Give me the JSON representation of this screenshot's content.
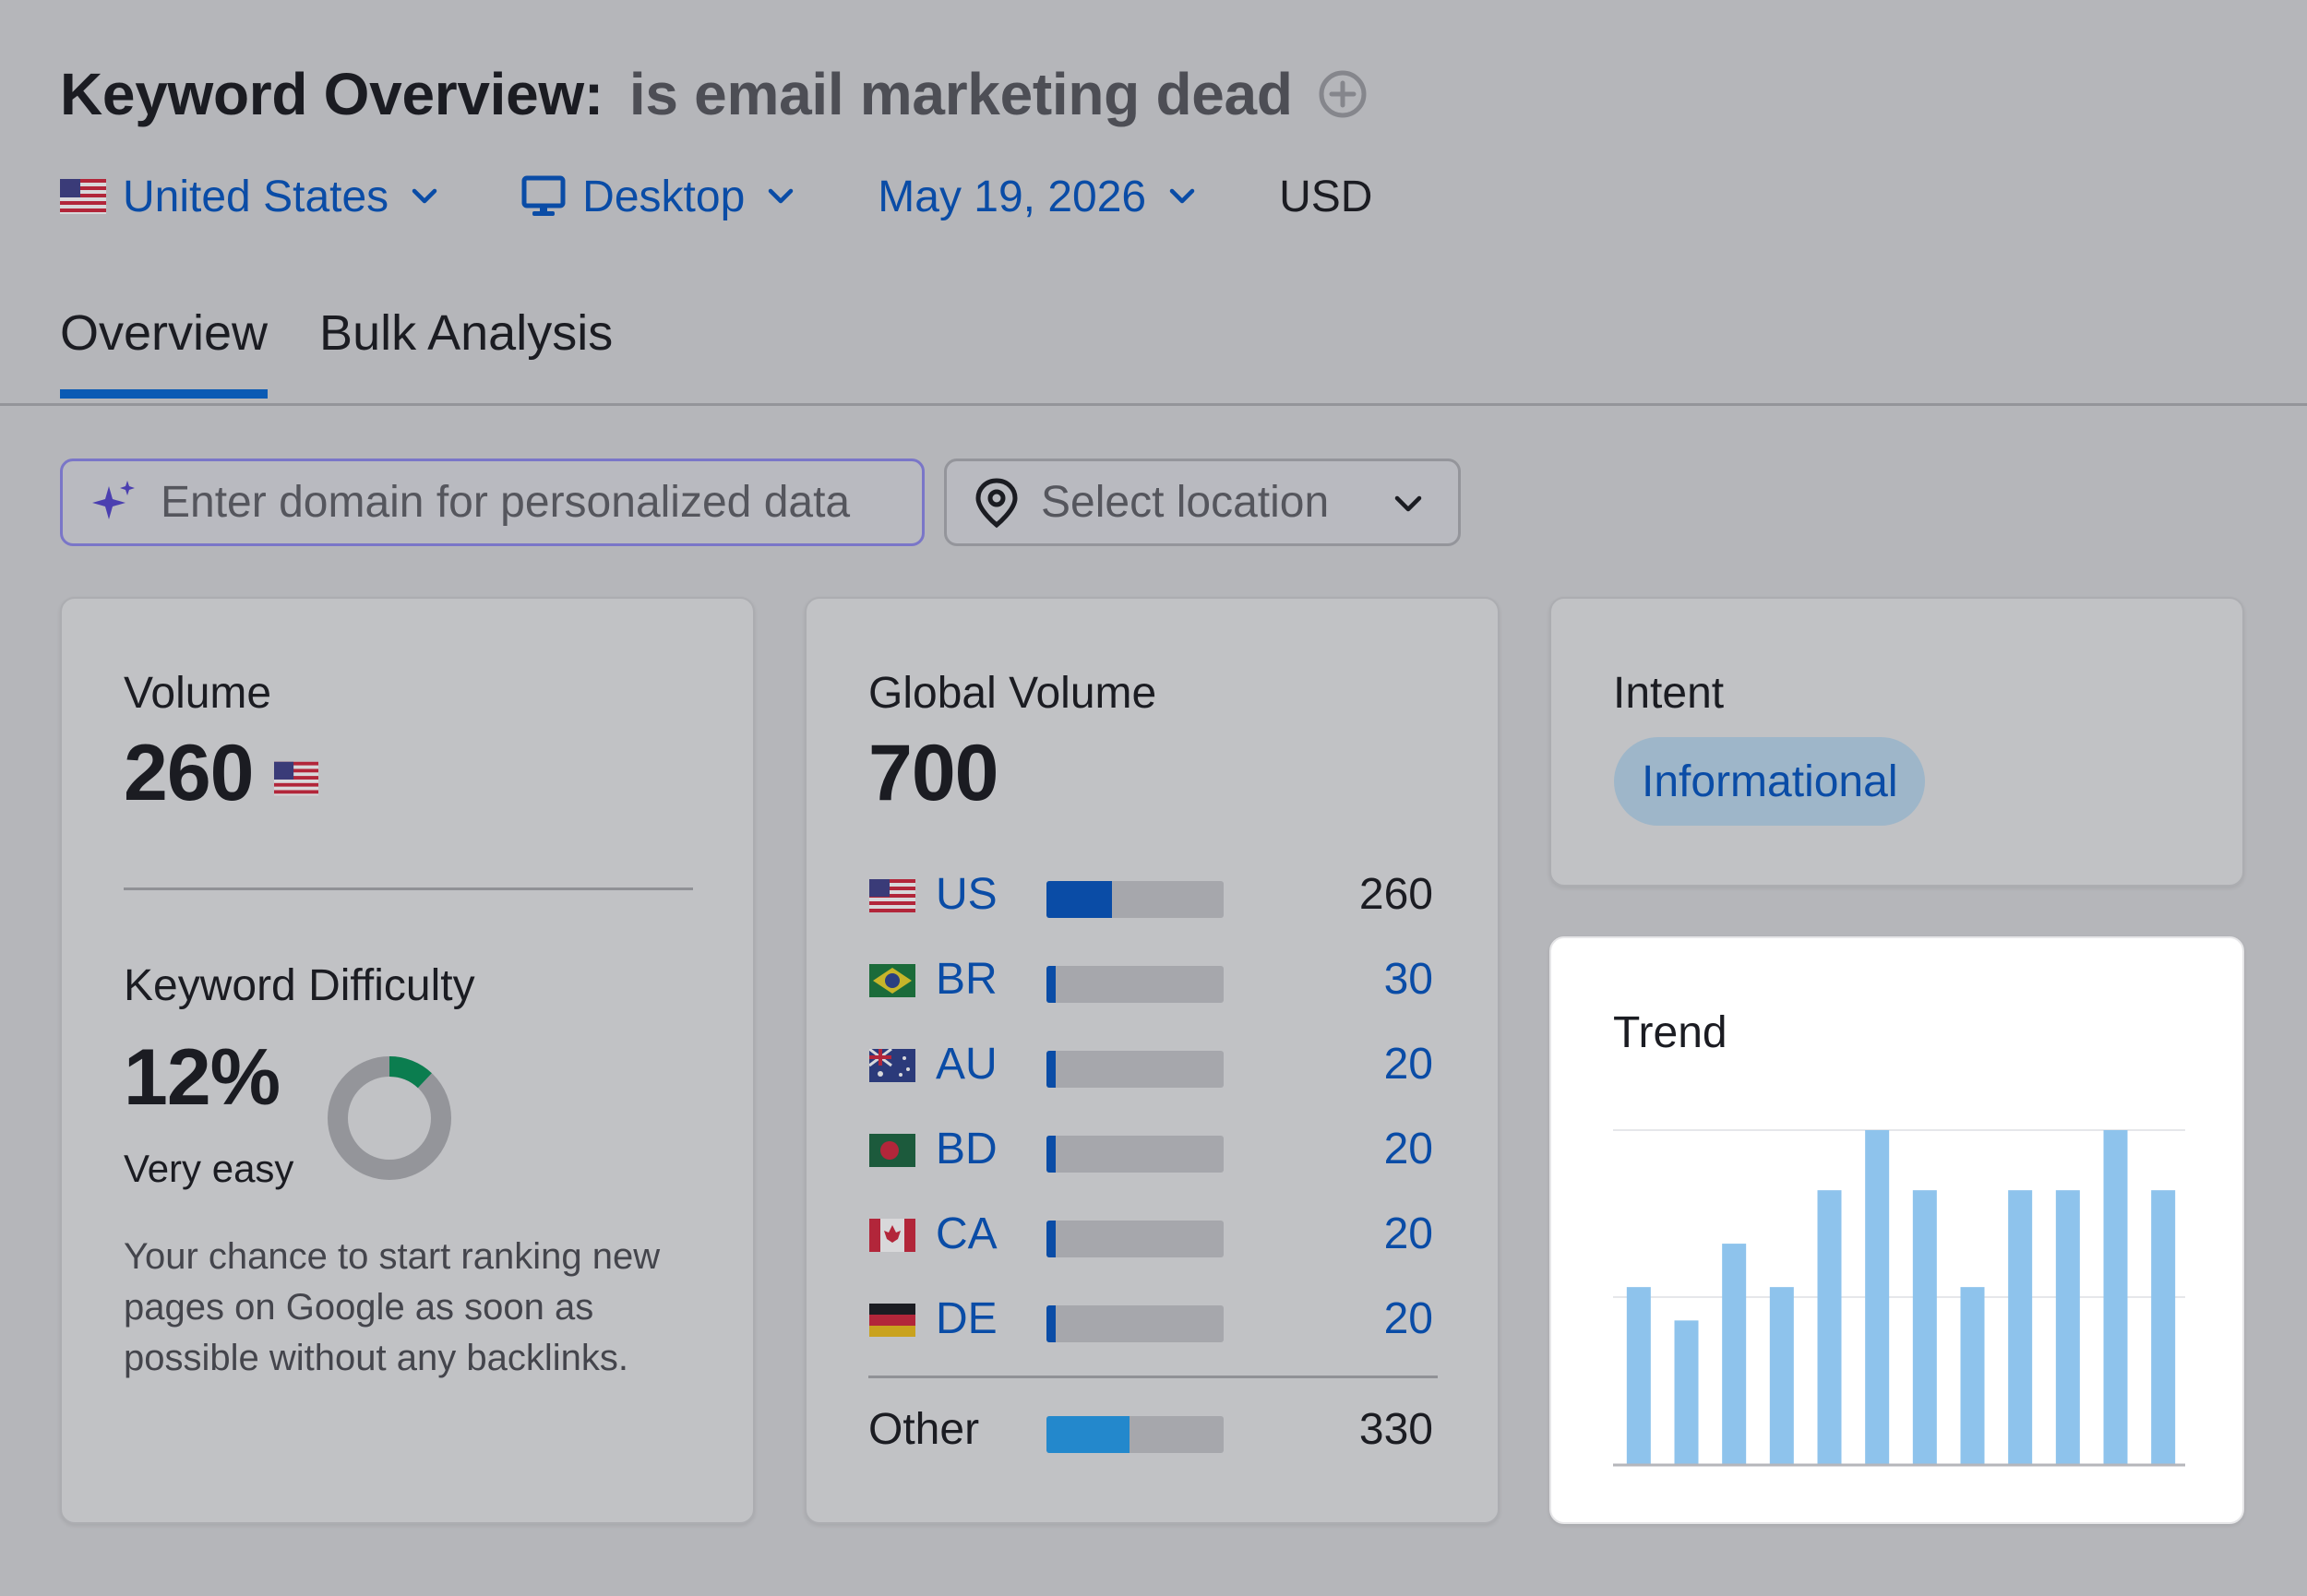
{
  "header": {
    "title": "Keyword Overview:",
    "keyword": "is email marketing dead"
  },
  "filters": {
    "country": "United States",
    "device": "Desktop",
    "date": "May 19, 2026",
    "currency": "USD"
  },
  "tabs": [
    {
      "label": "Overview",
      "active": true
    },
    {
      "label": "Bulk Analysis",
      "active": false
    }
  ],
  "domain_input": {
    "placeholder": "Enter domain for personalized data"
  },
  "location_select": {
    "label": "Select location"
  },
  "volume_card": {
    "title": "Volume",
    "value": "260",
    "kd_title": "Keyword Difficulty",
    "kd_value": "12%",
    "kd_percent": 12,
    "kd_label": "Very easy",
    "kd_description": "Your chance to start ranking new pages on Google as soon as possible without any backlinks."
  },
  "global_card": {
    "title": "Global Volume",
    "value": "700",
    "countries": [
      {
        "code": "US",
        "value": "260",
        "share": 0.37
      },
      {
        "code": "BR",
        "value": "30",
        "share": 0.04
      },
      {
        "code": "AU",
        "value": "20",
        "share": 0.03
      },
      {
        "code": "BD",
        "value": "20",
        "share": 0.03
      },
      {
        "code": "CA",
        "value": "20",
        "share": 0.03
      },
      {
        "code": "DE",
        "value": "20",
        "share": 0.03
      }
    ],
    "other": {
      "label": "Other",
      "value": "330",
      "share": 0.47
    }
  },
  "intent_card": {
    "title": "Intent",
    "badge": "Informational"
  },
  "trend_card": {
    "title": "Trend"
  },
  "chart_data": {
    "type": "bar",
    "title": "Trend",
    "values": [
      0.53,
      0.43,
      0.66,
      0.53,
      0.82,
      1.0,
      0.82,
      0.53,
      0.82,
      0.82,
      1.0,
      0.82
    ],
    "ylim": [
      0,
      1
    ],
    "grid": true,
    "color": "#8ec3ec"
  },
  "colors": {
    "accent": "#0a4ca6",
    "difficulty_green": "#0b7d4f",
    "bar_light": "#8ec3ec",
    "other_bar": "#2388cc"
  }
}
